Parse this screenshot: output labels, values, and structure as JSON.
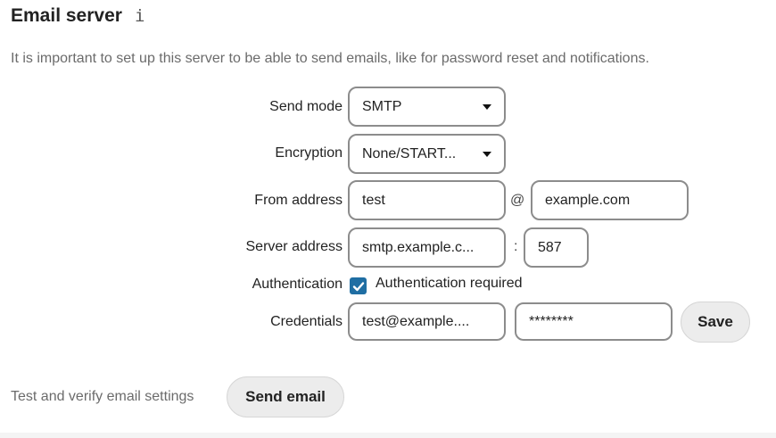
{
  "header": {
    "title": "Email server",
    "info_icon": "i",
    "description": "It is important to set up this server to be able to send emails, like for password reset and notifications."
  },
  "form": {
    "send_mode": {
      "label": "Send mode",
      "value": "SMTP"
    },
    "encryption": {
      "label": "Encryption",
      "value": "None/START..."
    },
    "from_address": {
      "label": "From address",
      "local": "test",
      "at": "@",
      "domain": "example.com"
    },
    "server_address": {
      "label": "Server address",
      "host": "smtp.example.c...",
      "colon": ":",
      "port": "587"
    },
    "authentication": {
      "label": "Authentication",
      "checkbox_label": "Authentication required",
      "checked": true
    },
    "credentials": {
      "label": "Credentials",
      "username": "test@example....",
      "password": "********",
      "save_label": "Save"
    }
  },
  "test": {
    "label": "Test and verify email settings",
    "button_label": "Send email"
  },
  "colors": {
    "accent": "#1f6ea3",
    "field_border": "#8c8c8c",
    "button_bg": "#ececec",
    "muted_text": "#6b6b6b"
  }
}
